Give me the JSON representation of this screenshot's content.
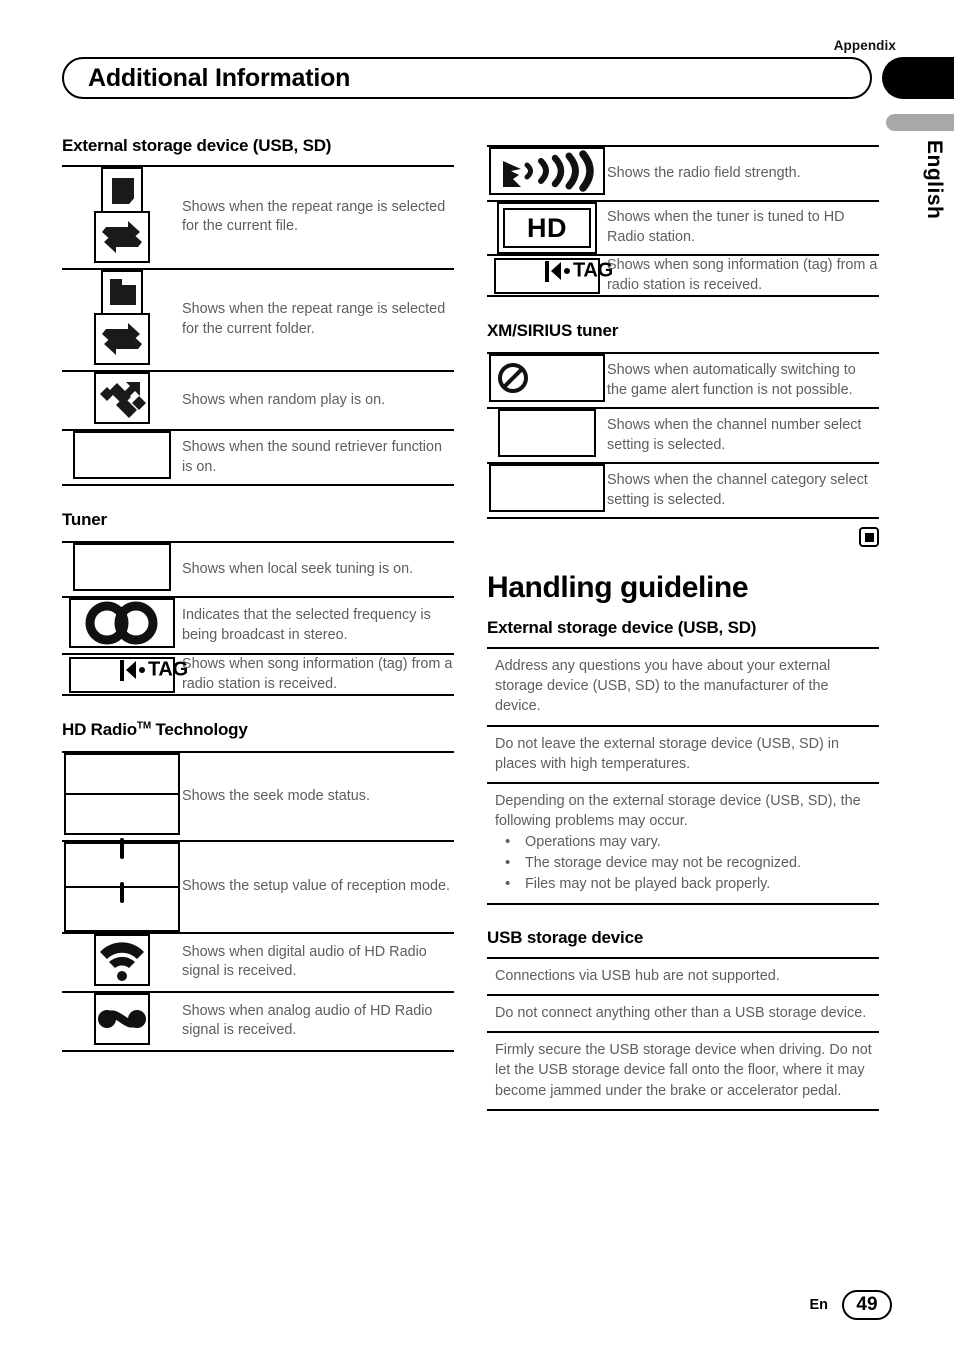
{
  "page": {
    "appendix_label": "Appendix",
    "language_tab": "English",
    "title": "Additional Information",
    "footer_lang": "En",
    "footer_page": "49"
  },
  "left_column": {
    "sections": [
      {
        "heading": "External storage device (USB, SD)",
        "rows": [
          {
            "icon": "repeat-file-icon",
            "desc": "Shows when the repeat range is selected for the current file."
          },
          {
            "icon": "repeat-folder-icon",
            "desc": "Shows when the repeat range is selected for the current folder."
          },
          {
            "icon": "random-play-icon",
            "desc": "Shows when random play is on."
          },
          {
            "icon": "sound-retriever-icon",
            "desc": "Shows when the sound retriever function is on."
          }
        ]
      },
      {
        "heading": "Tuner",
        "rows": [
          {
            "icon": "local-seek-icon",
            "desc": "Shows when local seek tuning is on."
          },
          {
            "icon": "stereo-icon",
            "desc": "Indicates that the selected frequency is being broadcast in stereo."
          },
          {
            "icon": "tag-icon",
            "desc": "Shows when song information (tag) from a radio station is received."
          }
        ]
      },
      {
        "heading": "HD Radio",
        "heading_sup": "TM",
        "heading_tail": " Technology",
        "rows": [
          {
            "icon": "seek-mode-icon",
            "desc": "Shows the seek mode status."
          },
          {
            "icon": "reception-mode-icon",
            "desc": "Shows the setup value of reception mode."
          },
          {
            "icon": "digital-audio-icon",
            "desc": "Shows when digital audio of HD Radio signal is received."
          },
          {
            "icon": "analog-audio-icon",
            "desc": "Shows when analog audio of HD Radio signal is received."
          }
        ]
      }
    ]
  },
  "right_column": {
    "radio_rows": [
      {
        "icon": "field-strength-icon",
        "desc": "Shows the radio field strength."
      },
      {
        "icon": "hd-badge-icon",
        "desc": "Shows when the tuner is tuned to HD Radio station."
      },
      {
        "icon": "tag-icon",
        "desc": "Shows when song information (tag) from a radio station is received."
      }
    ],
    "xm_sirius": {
      "heading": "XM/SIRIUS tuner",
      "rows": [
        {
          "icon": "prohibited-icon",
          "desc": "Shows when automatically switching to the game alert function is not possible."
        },
        {
          "icon": "channel-number-icon",
          "desc": "Shows when the channel number select setting is selected."
        },
        {
          "icon": "channel-category-icon",
          "desc": "Shows when the channel category select setting is selected."
        }
      ]
    },
    "handling": {
      "title": "Handling guideline",
      "external_storage": {
        "heading": "External storage device (USB, SD)",
        "items": [
          {
            "text": "Address any questions you have about your external storage device (USB, SD) to the manufacturer of the device."
          },
          {
            "text": "Do not leave the external storage device (USB, SD) in places with high temperatures."
          },
          {
            "text": "Depending on the external storage device (USB, SD), the following problems may occur.",
            "bullets": [
              "Operations may vary.",
              "The storage device may not be recognized.",
              "Files may not be played back properly."
            ]
          }
        ]
      },
      "usb_storage": {
        "heading": "USB storage device",
        "items": [
          {
            "text": "Connections via USB hub are not supported."
          },
          {
            "text": "Do not connect anything other than a USB storage device."
          },
          {
            "text": "Firmly secure the USB storage device when driving. Do not let the USB storage device fall onto the floor, where it may become jammed under the brake or accelerator pedal."
          }
        ]
      }
    }
  }
}
